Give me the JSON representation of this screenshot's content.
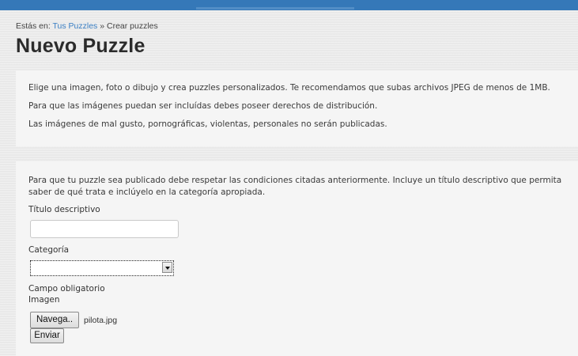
{
  "breadcrumb": {
    "prefix": "Estás en:",
    "link": "Tus Puzzles",
    "separator": "»",
    "current": "Crear puzzles"
  },
  "page_title": "Nuevo Puzzle",
  "info": {
    "lines": [
      "Elige una imagen, foto o dibujo y crea puzzles personalizados. Te recomendamos que subas archivos JPEG de menos de 1MB.",
      "Para que las imágenes puedan ser incluídas debes poseer derechos de distribución.",
      "Las imágenes de mal gusto, pornográficas, violentas, personales no serán publicadas."
    ]
  },
  "form": {
    "conditions": "Para que tu puzzle sea publicado debe respetar las condiciones citadas anteriormente. Incluye un título descriptivo que permita saber de qué trata e inclúyelo en la categoría apropiada.",
    "title_label": "Título descriptivo",
    "title_value": "",
    "category_label": "Categoría",
    "category_value": "",
    "required_note": "Campo obligatorio",
    "image_label": "Imagen",
    "browse_label": "Navega..",
    "file_name": "pilota.jpg",
    "submit_label": "Enviar"
  },
  "colors": {
    "topbar": "#3578b8",
    "link": "#3a7fc4"
  }
}
